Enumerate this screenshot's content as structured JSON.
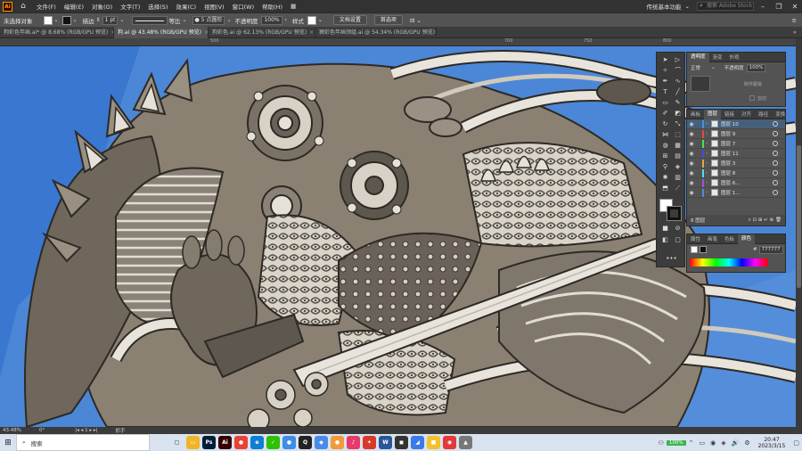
{
  "menubar": {
    "logo": "Ai",
    "items": [
      "文件(F)",
      "编辑(E)",
      "对象(O)",
      "文字(T)",
      "选择(S)",
      "效果(C)",
      "视图(V)",
      "窗口(W)",
      "帮助(H)"
    ],
    "workspace": "传统基本功能",
    "search_placeholder": "搜索 Adobe Stock"
  },
  "controlbar": {
    "selection": "未选择对象",
    "stroke_label": "描边",
    "stroke_weight": "1 pt",
    "brush_label": "等比",
    "brush_name": "5 点圆形",
    "opacity_label": "不透明度",
    "opacity_value": "100%",
    "style_label": "样式",
    "doc_setup": "文档设置",
    "preferences": "首选项"
  },
  "tabs": [
    {
      "label": "狗彩色年画.ai* @ 8.68% (RGB/GPU 预览)",
      "active": false
    },
    {
      "label": "狗.ai @ 43.48% (RGB/GPU 预览)",
      "active": true
    },
    {
      "label": "狗彩色.ai @ 62.13% (RGB/GPU 预览)",
      "active": false
    },
    {
      "label": "狮彩色年画领组.ai @ 54.34% (RGB/GPU 预览)",
      "active": false
    }
  ],
  "ruler": {
    "labels": [
      "500",
      "700",
      "750",
      "800"
    ]
  },
  "transparency": {
    "tabs": [
      "透明度",
      "渐变",
      "外观"
    ],
    "mode": "正常",
    "opacity_label": "不透明度",
    "opacity": "100%",
    "btn_mask": "制作蒙版",
    "clip_label": "剪切",
    "invert_label": "反相蒙版"
  },
  "layers": {
    "tabs": [
      "画板",
      "图层",
      "链接",
      "对齐",
      "路径",
      "变换"
    ],
    "rows": [
      {
        "name": "图层 10",
        "color": "#4a90e2",
        "selected": true
      },
      {
        "name": "图层 9",
        "color": "#e24a4a",
        "selected": false
      },
      {
        "name": "图层 7",
        "color": "#4ae24a",
        "selected": false
      },
      {
        "name": "图层 11",
        "color": "#4a4ae2",
        "selected": false
      },
      {
        "name": "图层 3",
        "color": "#e2a94a",
        "selected": false
      },
      {
        "name": "图层 8",
        "color": "#4ae2e2",
        "selected": false
      },
      {
        "name": "图层 6...",
        "color": "#a94ae2",
        "selected": false
      },
      {
        "name": "图层 1...",
        "color": "#4a90e2",
        "selected": false
      }
    ],
    "footer": "8 图层"
  },
  "color_panel": {
    "tabs": [
      "属性",
      "画笔",
      "色板",
      "颜色"
    ],
    "hex_label": "#",
    "hex": "777777"
  },
  "statusbar": {
    "zoom": "43.48%",
    "rotation": "0°",
    "page": "1",
    "tool": "抓手"
  },
  "taskbar": {
    "search": "搜索",
    "apps": [
      {
        "name": "task-view",
        "label": "▢",
        "color": "#d9e2ef"
      },
      {
        "name": "file-explorer",
        "label": "▭",
        "color": "#f0b429"
      },
      {
        "name": "photoshop",
        "label": "Ps",
        "color": "#001e36"
      },
      {
        "name": "illustrator",
        "label": "Ai",
        "color": "#330000"
      },
      {
        "name": "chrome",
        "label": "●",
        "color": "#e94235"
      },
      {
        "name": "edge",
        "label": "e",
        "color": "#0f7fd4"
      },
      {
        "name": "wechat",
        "label": "✓",
        "color": "#2dc100"
      },
      {
        "name": "browser",
        "label": "●",
        "color": "#3d8de8"
      },
      {
        "name": "qq",
        "label": "Q",
        "color": "#222"
      },
      {
        "name": "app-blue",
        "label": "◆",
        "color": "#4a8ae8"
      },
      {
        "name": "app-orange",
        "label": "●",
        "color": "#f09a3a"
      },
      {
        "name": "app-music",
        "label": "♪",
        "color": "#e83a6a"
      },
      {
        "name": "app-game",
        "label": "✦",
        "color": "#d83a2a"
      },
      {
        "name": "app-word",
        "label": "W",
        "color": "#2b579a"
      },
      {
        "name": "app-dark",
        "label": "◼",
        "color": "#333"
      },
      {
        "name": "app-blue2",
        "label": "◢",
        "color": "#3a7ae8"
      },
      {
        "name": "app-yellow",
        "label": "■",
        "color": "#f2c12e"
      },
      {
        "name": "app-red",
        "label": "◉",
        "color": "#e23a3a"
      },
      {
        "name": "app-gray",
        "label": "▲",
        "color": "#777"
      }
    ],
    "battery": "100%",
    "time": "20:47",
    "date": "2023/3/15"
  }
}
